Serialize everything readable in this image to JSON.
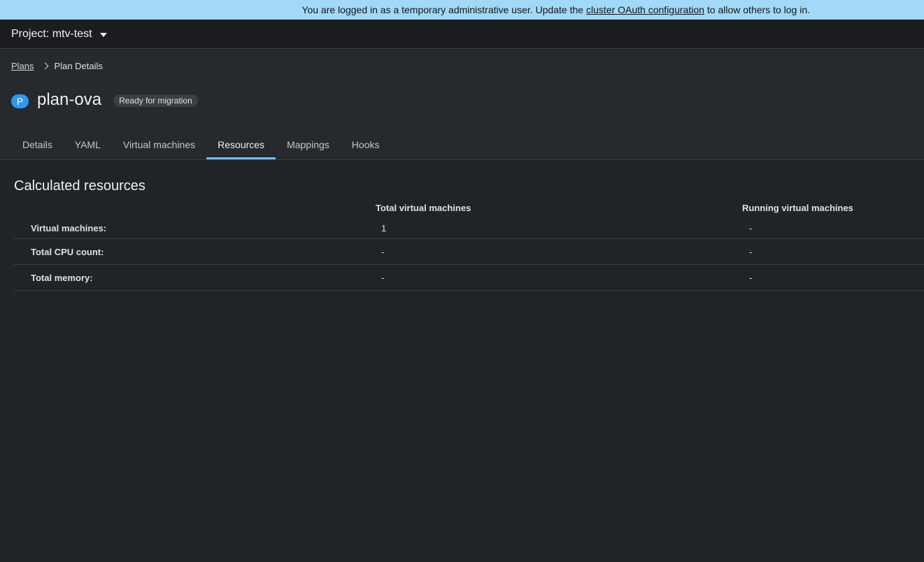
{
  "banner": {
    "prefix": "You are logged in as a temporary administrative user. Update the",
    "link": "cluster OAuth configuration",
    "suffix": "to allow others to log in."
  },
  "project": {
    "label": "Project: mtv-test"
  },
  "breadcrumb": {
    "parent": "Plans",
    "current": "Plan Details"
  },
  "plan": {
    "badge": "P",
    "name": "plan-ova",
    "status": "Ready for migration"
  },
  "tabs": [
    {
      "label": "Details"
    },
    {
      "label": "YAML"
    },
    {
      "label": "Virtual machines"
    },
    {
      "label": "Resources"
    },
    {
      "label": "Mappings"
    },
    {
      "label": "Hooks"
    }
  ],
  "active_tab": "Resources",
  "resources": {
    "title": "Calculated resources",
    "columns": [
      "Total virtual machines",
      "Running virtual machines"
    ],
    "rows": [
      {
        "label": "Virtual machines:",
        "total": "1",
        "running": "-"
      },
      {
        "label": "Total CPU count:",
        "total": "-",
        "running": "-"
      },
      {
        "label": "Total memory:",
        "total": "-",
        "running": "-"
      }
    ]
  },
  "colors": {
    "banner": "#a2d9f9",
    "accent": "#73bcf7",
    "badge": "#2b9af3",
    "background": "#1b1d21"
  }
}
